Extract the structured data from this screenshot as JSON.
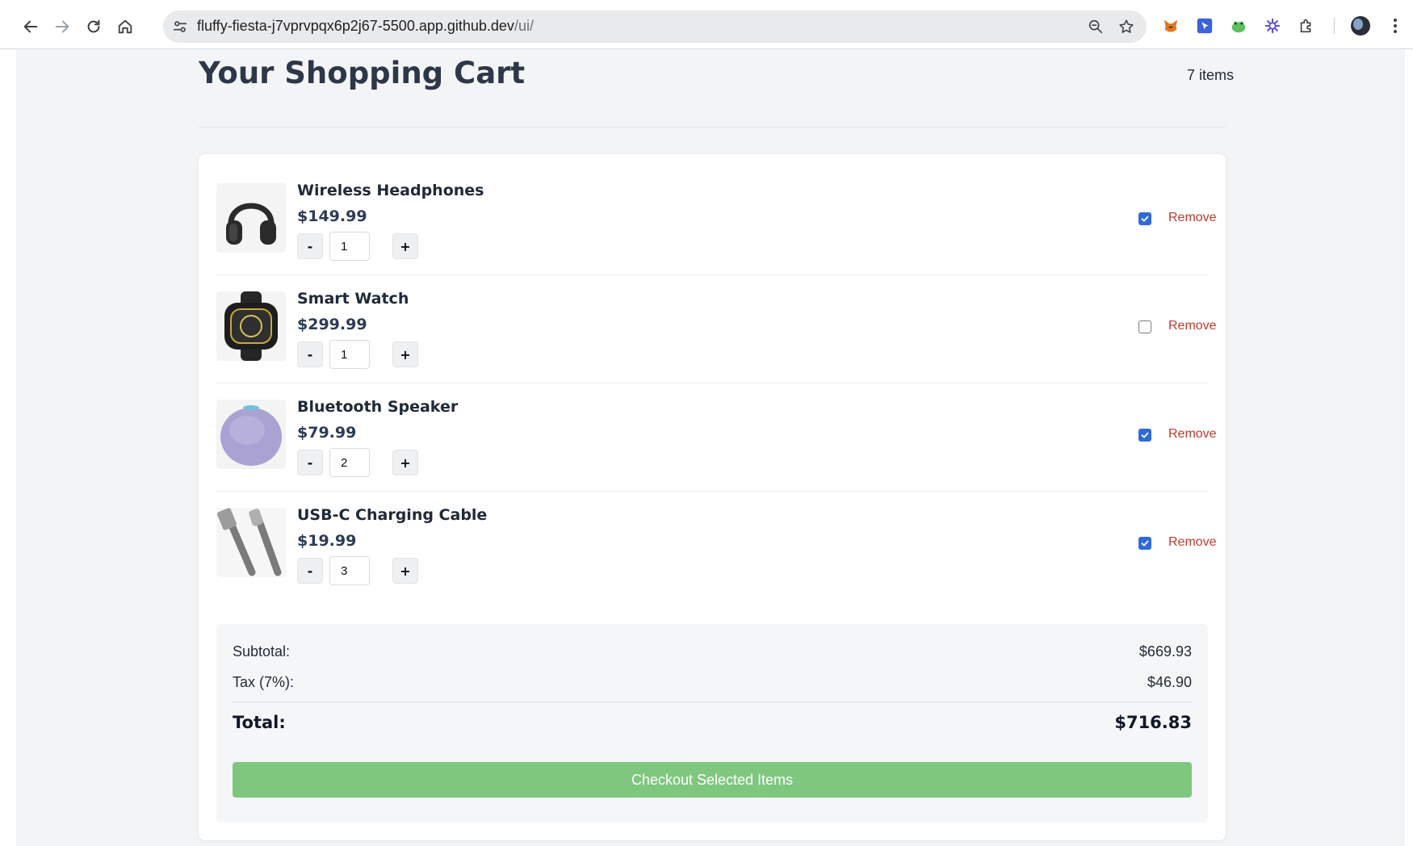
{
  "browser": {
    "url_host": "fluffy-fiesta-j7vprvpqx6p2j67-5500.app.github.dev",
    "url_path": "/ui/",
    "icons": {
      "back": "back-arrow-icon",
      "forward": "forward-arrow-icon",
      "reload": "reload-icon",
      "home": "home-icon",
      "site_info": "tune-icon",
      "zoom": "zoom-icon",
      "bookmark": "star-icon",
      "extensions": [
        "metamask-fox-icon",
        "cursor-extension-icon",
        "frog-extension-icon",
        "purple-gear-icon",
        "puzzle-icon"
      ],
      "profile": "avatar",
      "menu": "kebab-menu-icon"
    }
  },
  "cart": {
    "title": "Your Shopping Cart",
    "items_count": "7 items",
    "items": [
      {
        "name": "Wireless Headphones",
        "price": "$149.99",
        "quantity": "1",
        "selected": true,
        "remove_label": "Remove",
        "image": "headphones"
      },
      {
        "name": "Smart Watch",
        "price": "$299.99",
        "quantity": "1",
        "selected": false,
        "remove_label": "Remove",
        "image": "smartwatch"
      },
      {
        "name": "Bluetooth Speaker",
        "price": "$79.99",
        "quantity": "2",
        "selected": true,
        "remove_label": "Remove",
        "image": "speaker"
      },
      {
        "name": "USB-C Charging Cable",
        "price": "$19.99",
        "quantity": "3",
        "selected": true,
        "remove_label": "Remove",
        "image": "usb-cable"
      }
    ],
    "decrement_label": "-",
    "increment_label": "+"
  },
  "summary": {
    "subtotal_label": "Subtotal:",
    "subtotal_value": "$669.93",
    "tax_label": "Tax (7%):",
    "tax_value": "$46.90",
    "total_label": "Total:",
    "total_value": "$716.83",
    "checkout_label": "Checkout Selected Items"
  },
  "colors": {
    "checkout_button": "#7fc77f",
    "remove_link": "#c0392b",
    "checkbox_checked": "#2f6bd8",
    "page_background": "#f3f4f6"
  }
}
